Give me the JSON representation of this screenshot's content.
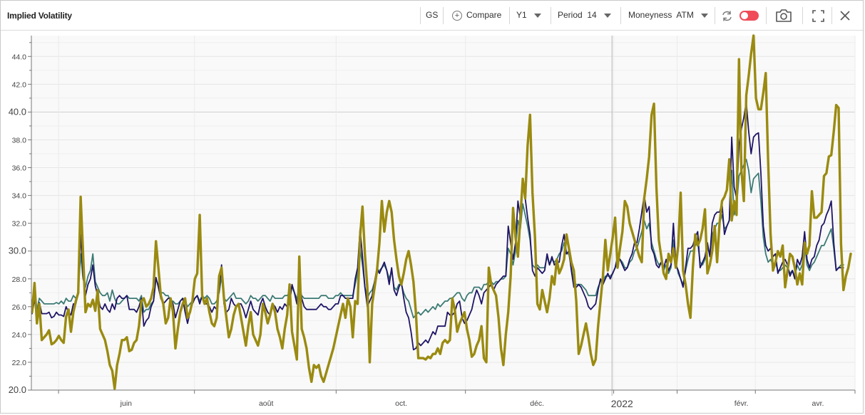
{
  "toolbar": {
    "title": "Implied Volatility",
    "ticker": "GS",
    "compare_label": "Compare",
    "range_label": "Y1",
    "period_label": "Period",
    "period_value": "14",
    "moneyness_label": "Moneyness",
    "moneyness_value": "ATM"
  },
  "icons": [
    "plus-circle-icon",
    "caret-down-icon",
    "refresh-icon",
    "toggle-switch",
    "camera-icon",
    "fullscreen-icon",
    "close-icon"
  ],
  "colors": {
    "series_gold": "#9a8a10",
    "series_navy": "#1e1466",
    "series_teal": "#3c7a74",
    "toggle": "#f04b58"
  },
  "chart_data": {
    "type": "line",
    "ylim": [
      20,
      45.5
    ],
    "yticks": [
      "20.0",
      "22.0",
      "24.0",
      "26.0",
      "28.0",
      "30.0",
      "32.0",
      "34.0",
      "36.0",
      "38.0",
      "40.0",
      "42.0",
      "44.0"
    ],
    "xticks": [
      "juin",
      "août",
      "oct.",
      "déc.",
      "2022",
      "févr.",
      "avr."
    ],
    "series": [
      {
        "color": "#9a8a10",
        "values": [
          25.6,
          27.7,
          24.8,
          26.2,
          23.6,
          23.8,
          24.0,
          24.3,
          23.3,
          23.4,
          23.6,
          23.9,
          23.6,
          23.4,
          25.3,
          25.8,
          24.2,
          25.6,
          26.4,
          27.0,
          33.9,
          29.8,
          25.6,
          26.2,
          26.0,
          26.5,
          25.7,
          27.2,
          24.4,
          24.0,
          23.6,
          22.8,
          21.8,
          21.4,
          20.1,
          21.8,
          22.6,
          23.6,
          23.6,
          23.8,
          22.8,
          22.9,
          23.4,
          23.6,
          24.6,
          26.4,
          26.6,
          26.0,
          26.2,
          26.6,
          27.4,
          30.7,
          28.8,
          26.8,
          26.2,
          24.8,
          25.2,
          26.6,
          25.6,
          23.0,
          24.4,
          25.6,
          26.2,
          26.6,
          25.2,
          25.6,
          26.4,
          28.0,
          28.4,
          32.6,
          26.8,
          26.2,
          26.6,
          25.6,
          24.8,
          24.6,
          25.2,
          28.2,
          28.8,
          26.6,
          25.2,
          23.8,
          24.4,
          25.4,
          26.0,
          26.2,
          25.2,
          24.2,
          23.2,
          24.6,
          25.6,
          24.0,
          23.6,
          23.2,
          24.0,
          26.2,
          25.6,
          24.8,
          25.4,
          26.2,
          25.6,
          24.4,
          23.8,
          23.0,
          24.4,
          25.4,
          27.6,
          24.2,
          23.2,
          22.2,
          29.6,
          24.4,
          23.8,
          23.0,
          21.6,
          20.6,
          21.8,
          21.6,
          21.8,
          21.0,
          20.6,
          21.2,
          21.8,
          22.4,
          23.0,
          23.8,
          24.6,
          25.4,
          26.2,
          25.2,
          26.6,
          26.0,
          23.8,
          26.4,
          26.2,
          31.0,
          33.2,
          29.8,
          27.4,
          22.0,
          26.2,
          27.4,
          28.6,
          30.6,
          33.6,
          31.4,
          32.8,
          33.6,
          32.8,
          30.8,
          29.4,
          28.2,
          27.6,
          28.4,
          29.4,
          30.0,
          29.0,
          27.8,
          25.6,
          22.3,
          22.3,
          22.3,
          22.2,
          22.4,
          22.3,
          22.6,
          22.6,
          23.0,
          22.6,
          23.4,
          23.6,
          23.4,
          23.6,
          26.6,
          25.8,
          24.2,
          24.8,
          25.2,
          25.6,
          24.4,
          23.6,
          22.4,
          22.6,
          23.2,
          23.6,
          24.6,
          22.3,
          22.0,
          28.8,
          27.6,
          27.2,
          26.8,
          25.2,
          23.0,
          21.8,
          24.0,
          25.6,
          28.2,
          33.1,
          31.0,
          29.6,
          32.4,
          35.2,
          33.8,
          37.6,
          39.8,
          34.2,
          31.0,
          26.2,
          25.8,
          27.2,
          26.4,
          25.6,
          26.6,
          28.2,
          27.6,
          29.4,
          28.4,
          28.8,
          29.4,
          31.2,
          30.2,
          29.2,
          28.6,
          26.4,
          22.6,
          23.2,
          24.0,
          24.8,
          23.8,
          22.6,
          21.8,
          22.2,
          24.6,
          26.4,
          28.2,
          30.8,
          28.6,
          29.8,
          31.0,
          32.4,
          28.8,
          30.2,
          31.4,
          33.6,
          33.2,
          32.0,
          31.4,
          30.8,
          30.2,
          29.6,
          29.2,
          33.8,
          35.2,
          36.8,
          39.8,
          40.6,
          34.6,
          30.8,
          29.6,
          28.4,
          28.0,
          29.8,
          29.2,
          30.2,
          28.8,
          30.4,
          34.2,
          28.6,
          27.6,
          26.2,
          25.2,
          28.8,
          31.2,
          30.4,
          30.8,
          31.6,
          33.0,
          28.4,
          29.0,
          30.0,
          31.8,
          29.2,
          32.0,
          33.6,
          33.9,
          34.4,
          36.6,
          32.2,
          33.6,
          32.6,
          43.8,
          35.8,
          33.6,
          41.2,
          42.6,
          44.2,
          45.5,
          41.0,
          40.2,
          40.2,
          41.4,
          42.8,
          36.4,
          31.2,
          28.6,
          29.2,
          30.0,
          29.6,
          30.4,
          27.4,
          28.6,
          29.8,
          29.6,
          28.8,
          27.6,
          28.4,
          27.6,
          30.6,
          29.8,
          30.4,
          34.3,
          32.4,
          32.4,
          32.6,
          32.8,
          35.4,
          35.6,
          36.8,
          36.9,
          38.6,
          40.5,
          40.3,
          30.5,
          27.2,
          28.2,
          28.8,
          29.8
        ]
      },
      {
        "color": "#1e1466",
        "values": [
          25.5,
          26.5,
          25.4,
          26.3,
          25.5,
          25.5,
          25.5,
          25.6,
          25.2,
          25.3,
          25.6,
          25.4,
          25.4,
          25.3,
          26.0,
          25.6,
          25.4,
          26.2,
          26.2,
          27.0,
          31.2,
          28.2,
          26.8,
          27.6,
          28.0,
          29.0,
          27.5,
          26.8,
          26.0,
          25.8,
          26.2,
          25.8,
          25.6,
          26.2,
          25.8,
          26.6,
          26.8,
          26.6,
          26.6,
          26.8,
          25.8,
          25.8,
          25.8,
          25.6,
          26.0,
          26.6,
          24.6,
          25.0,
          25.2,
          26.0,
          26.4,
          28.1,
          27.4,
          26.6,
          26.2,
          26.4,
          26.6,
          26.6,
          26.2,
          25.2,
          25.8,
          26.4,
          26.6,
          25.6,
          24.8,
          25.6,
          26.2,
          26.6,
          26.8,
          26.2,
          26.8,
          26.2,
          26.2,
          26.0,
          25.6,
          26.0,
          25.8,
          27.2,
          29.0,
          26.2,
          25.6,
          25.8,
          26.6,
          26.2,
          26.0,
          26.2,
          26.2,
          25.8,
          25.2,
          25.8,
          26.4,
          25.8,
          25.6,
          25.4,
          26.2,
          26.6,
          26.0,
          25.6,
          25.4,
          26.2,
          26.0,
          25.6,
          26.0,
          25.8,
          26.2,
          26.0,
          26.2,
          27.6,
          27.0,
          26.2,
          28.0,
          26.6,
          26.0,
          25.8,
          25.8,
          25.8,
          25.8,
          25.8,
          26.0,
          26.2,
          26.0,
          26.0,
          25.8,
          25.8,
          26.0,
          26.2,
          26.2,
          26.8,
          26.8,
          26.6,
          26.6,
          26.6,
          26.6,
          28.0,
          28.8,
          31.6,
          29.6,
          27.4,
          26.0,
          26.4,
          26.8,
          27.8,
          28.8,
          28.4,
          28.8,
          29.2,
          28.6,
          27.6,
          28.8,
          27.2,
          26.8,
          27.4,
          27.8,
          26.6,
          25.6,
          25.2,
          24.2,
          22.9,
          23.0,
          23.4,
          23.2,
          23.4,
          23.6,
          23.4,
          23.8,
          24.2,
          24.0,
          24.6,
          24.6,
          24.6,
          24.6,
          25.6,
          25.4,
          25.4,
          25.6,
          26.2,
          26.4,
          25.2,
          24.8,
          25.0,
          25.4,
          25.8,
          26.6,
          27.2,
          26.8,
          26.2,
          27.0,
          27.2,
          27.4,
          27.6,
          27.2,
          27.6,
          27.8,
          28.0,
          28.2,
          28.2,
          31.8,
          30.6,
          29.4,
          30.6,
          33.6,
          32.4,
          34.9,
          33.8,
          32.4,
          31.2,
          28.6,
          28.2,
          28.8,
          28.6,
          28.4,
          28.6,
          29.8,
          29.0,
          29.6,
          29.0,
          29.2,
          29.2,
          30.4,
          31.2,
          29.8,
          30.0,
          28.6,
          27.4,
          27.4,
          27.6,
          27.4,
          27.0,
          26.6,
          26.0,
          25.8,
          26.0,
          26.2,
          27.2,
          28.0,
          27.6,
          28.0,
          28.4,
          28.0,
          28.4,
          28.8,
          29.6,
          29.4,
          29.0,
          28.6,
          28.8,
          29.4,
          29.8,
          30.6,
          30.6,
          31.6,
          32.8,
          34.0,
          32.8,
          33.2,
          30.2,
          29.8,
          29.0,
          28.8,
          29.2,
          28.8,
          29.4,
          28.6,
          29.0,
          32.0,
          29.0,
          28.6,
          28.0,
          27.4,
          28.8,
          30.2,
          30.2,
          30.4,
          31.0,
          31.4,
          28.8,
          29.2,
          29.6,
          30.6,
          29.6,
          32.0,
          32.6,
          32.8,
          32.8,
          33.4,
          31.2,
          31.8,
          32.2,
          38.2,
          34.6,
          33.8,
          37.6,
          38.8,
          39.6,
          40.7,
          38.6,
          37.0,
          38.2,
          38.4,
          38.5,
          35.6,
          31.8,
          30.4,
          30.0,
          30.2,
          29.6,
          29.8,
          28.4,
          28.8,
          29.2,
          29.4,
          29.0,
          28.2,
          28.6,
          28.0,
          29.4,
          29.0,
          29.6,
          31.4,
          29.4,
          28.8,
          29.4,
          29.6,
          30.4,
          30.8,
          31.8,
          32.0,
          32.6,
          33.0,
          33.6,
          30.6,
          28.6,
          28.8,
          28.8,
          28.8
        ]
      },
      {
        "color": "#3c7a74",
        "values": [
          26.4,
          27.0,
          25.8,
          26.6,
          26.4,
          26.2,
          26.2,
          26.2,
          26.2,
          26.2,
          26.3,
          26.2,
          26.4,
          26.2,
          26.6,
          26.4,
          26.4,
          26.8,
          26.6,
          27.0,
          29.8,
          28.0,
          27.4,
          28.2,
          28.6,
          29.8,
          27.8,
          27.4,
          27.0,
          26.8,
          26.8,
          27.0,
          26.4,
          27.2,
          26.6,
          26.2,
          26.2,
          26.4,
          26.6,
          26.8,
          26.6,
          26.6,
          26.6,
          26.6,
          26.4,
          26.8,
          25.6,
          25.8,
          25.8,
          26.2,
          26.4,
          28.0,
          27.6,
          27.0,
          27.0,
          26.8,
          26.8,
          26.4,
          26.4,
          26.2,
          26.2,
          26.4,
          26.6,
          26.4,
          26.0,
          26.2,
          26.4,
          26.6,
          26.8,
          26.4,
          26.8,
          26.6,
          26.8,
          26.6,
          26.2,
          26.2,
          26.4,
          27.0,
          28.2,
          26.6,
          26.4,
          26.6,
          26.8,
          27.0,
          26.6,
          26.6,
          26.6,
          26.4,
          26.2,
          26.4,
          26.8,
          26.6,
          26.6,
          26.4,
          26.6,
          26.8,
          26.8,
          26.6,
          26.4,
          26.8,
          26.6,
          26.6,
          26.6,
          26.6,
          26.8,
          26.8,
          27.0,
          27.4,
          27.0,
          26.6,
          27.0,
          26.8,
          26.6,
          26.6,
          26.6,
          26.6,
          26.6,
          26.6,
          26.6,
          26.8,
          26.8,
          26.8,
          26.6,
          26.6,
          26.6,
          26.8,
          26.8,
          27.0,
          26.8,
          26.8,
          26.8,
          26.8,
          26.8,
          27.6,
          28.4,
          30.2,
          29.0,
          27.4,
          26.6,
          27.0,
          27.2,
          27.8,
          28.4,
          28.6,
          28.8,
          29.0,
          28.6,
          28.0,
          28.6,
          27.4,
          27.2,
          27.6,
          27.6,
          27.0,
          26.6,
          26.4,
          25.8,
          25.2,
          25.4,
          25.6,
          25.4,
          25.6,
          25.8,
          25.6,
          25.8,
          26.0,
          25.8,
          26.2,
          26.0,
          26.2,
          26.4,
          26.4,
          26.6,
          26.6,
          26.8,
          27.0,
          27.0,
          26.6,
          26.4,
          26.8,
          27.0,
          27.0,
          27.4,
          27.4,
          27.4,
          27.2,
          27.6,
          27.6,
          27.8,
          27.8,
          27.6,
          27.8,
          27.8,
          28.0,
          28.0,
          28.2,
          30.2,
          29.8,
          29.0,
          30.0,
          32.2,
          31.6,
          33.4,
          32.6,
          31.8,
          30.8,
          29.0,
          28.8,
          29.0,
          28.8,
          28.8,
          28.8,
          29.6,
          29.0,
          29.4,
          29.2,
          29.4,
          29.8,
          30.0,
          30.6,
          29.8,
          29.8,
          28.8,
          27.6,
          27.6,
          27.6,
          27.6,
          27.4,
          27.2,
          26.8,
          26.8,
          26.8,
          26.8,
          27.4,
          27.8,
          27.8,
          28.2,
          28.2,
          28.2,
          28.4,
          28.8,
          29.2,
          29.4,
          29.2,
          28.8,
          28.8,
          29.2,
          29.4,
          30.0,
          30.2,
          30.8,
          31.4,
          32.2,
          31.6,
          32.0,
          30.6,
          30.0,
          29.4,
          29.0,
          29.2,
          28.6,
          29.0,
          28.4,
          28.8,
          30.8,
          29.2,
          28.4,
          28.0,
          27.6,
          28.6,
          29.4,
          30.0,
          30.0,
          30.4,
          30.6,
          29.2,
          29.0,
          29.4,
          30.2,
          29.8,
          31.2,
          31.6,
          32.0,
          32.0,
          32.6,
          31.6,
          31.8,
          32.2,
          35.8,
          32.6,
          33.2,
          35.4,
          35.8,
          36.2,
          36.6,
          35.8,
          34.2,
          35.2,
          35.4,
          35.6,
          33.6,
          31.0,
          29.8,
          29.2,
          29.4,
          29.0,
          29.2,
          28.6,
          28.6,
          28.8,
          29.0,
          28.8,
          28.4,
          28.6,
          28.2,
          29.0,
          28.6,
          29.0,
          30.6,
          29.0,
          28.6,
          29.0,
          29.2,
          29.6,
          30.0,
          30.4,
          30.4,
          30.8,
          31.2,
          31.6,
          30.2,
          28.6,
          28.8,
          29.0,
          29.0
        ]
      }
    ]
  }
}
